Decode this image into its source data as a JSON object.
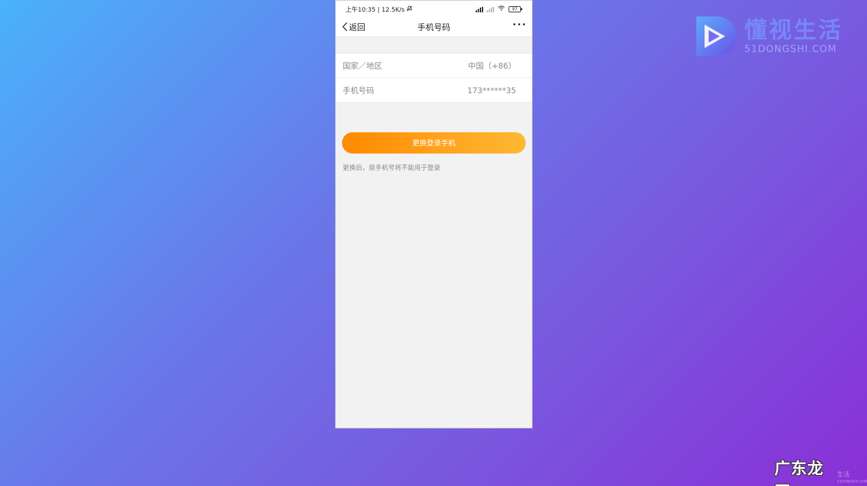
{
  "status_bar": {
    "time": "上午10:35 | 12.5K/s",
    "battery": "97"
  },
  "nav": {
    "back_label": "返回",
    "title": "手机号码"
  },
  "list": [
    {
      "label": "国家／地区",
      "value": "中国（+86）"
    },
    {
      "label": "手机号码",
      "value": "173******35"
    }
  ],
  "primary_button": "更换登录手机",
  "hint": "更换后，原手机号将不能用于登录",
  "logo": {
    "cn": "懂视生活",
    "en": "51DONGSHI.COM"
  },
  "watermark": {
    "text": "广东龙网",
    "small_top": "生活",
    "small_bottom": "51DONGSHI.COM"
  },
  "colors": {
    "button_start": "#ff8a00",
    "button_end": "#ffb833",
    "background_start": "#4ab2fb",
    "background_end": "#8a2fd6"
  }
}
